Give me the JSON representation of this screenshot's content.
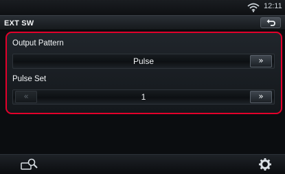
{
  "status_bar": {
    "time": "12:11",
    "wifi_icon": "wifi-icon"
  },
  "header": {
    "title": "EXT SW",
    "back_icon": "return-arrow-icon"
  },
  "settings": {
    "output_pattern": {
      "label": "Output Pattern",
      "value": "Pulse",
      "next_symbol": "»"
    },
    "pulse_set": {
      "label": "Pulse Set",
      "value": "1",
      "prev_symbol": "«",
      "next_symbol": "»"
    }
  },
  "bottom_bar": {
    "left_icon": "display-search-icon",
    "right_icon": "gear-icon"
  },
  "colors": {
    "highlight_border": "#e4002b",
    "background": "#0b0d10"
  }
}
